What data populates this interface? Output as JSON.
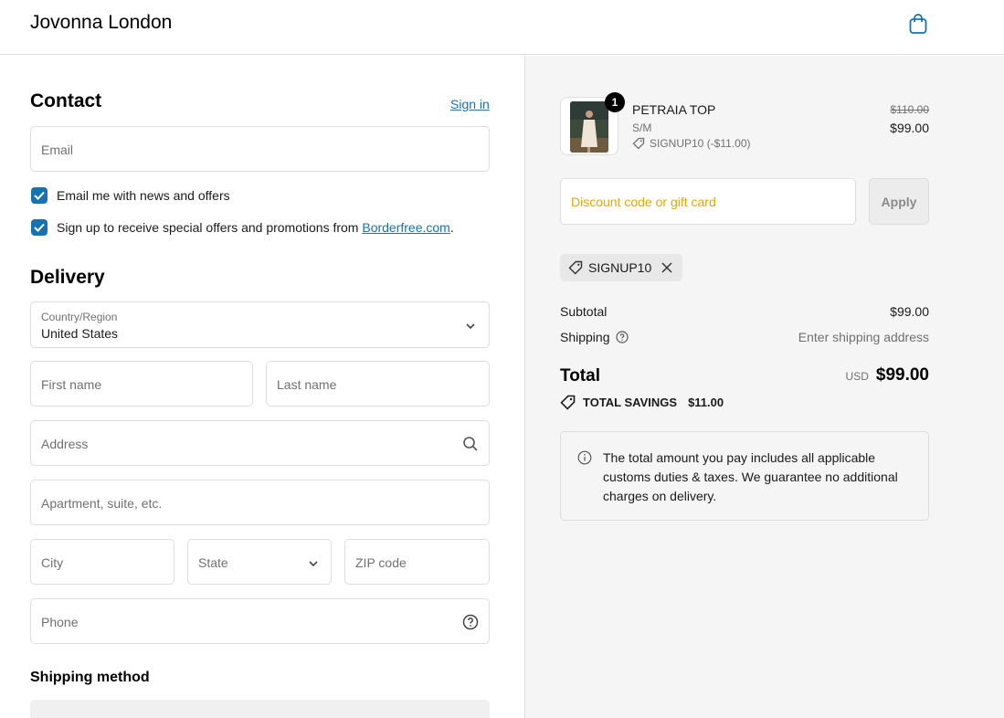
{
  "header": {
    "brand": "Jovonna London",
    "cart_icon": "bag-icon"
  },
  "contact": {
    "title": "Contact",
    "sign_in": "Sign in",
    "email_placeholder": "Email",
    "news_label": "Email me with news and offers",
    "offers_prefix": "Sign up to receive special offers and promotions from ",
    "offers_link": "Borderfree.com",
    "offers_suffix": "."
  },
  "delivery": {
    "title": "Delivery",
    "country_label": "Country/Region",
    "country_value": "United States",
    "first_name": "First name",
    "last_name": "Last name",
    "address": "Address",
    "apartment": "Apartment, suite, etc.",
    "city": "City",
    "state": "State",
    "zip": "ZIP code",
    "phone": "Phone"
  },
  "shipping_method": {
    "title": "Shipping method"
  },
  "summary": {
    "product": {
      "quantity": "1",
      "name": "PETRAIA TOP",
      "variant": "S/M",
      "discount": "SIGNUP10 (-$11.00)",
      "price_original": "$110.00",
      "price": "$99.00"
    },
    "discount_placeholder": "Discount code or gift card",
    "apply": "Apply",
    "applied_code": "SIGNUP10",
    "subtotal_label": "Subtotal",
    "subtotal_value": "$99.00",
    "shipping_label": "Shipping",
    "shipping_value": "Enter shipping address",
    "total_label": "Total",
    "currency": "USD",
    "total_value": "$99.00",
    "savings_label": "TOTAL SAVINGS",
    "savings_value": "$11.00",
    "info_text": "The total amount you pay includes all applicable customs duties & taxes. We guarantee no additional charges on delivery."
  },
  "colors": {
    "accent": "#1773b0",
    "summary_bg": "#f5f5f5",
    "discount_placeholder": "#e3a800"
  }
}
